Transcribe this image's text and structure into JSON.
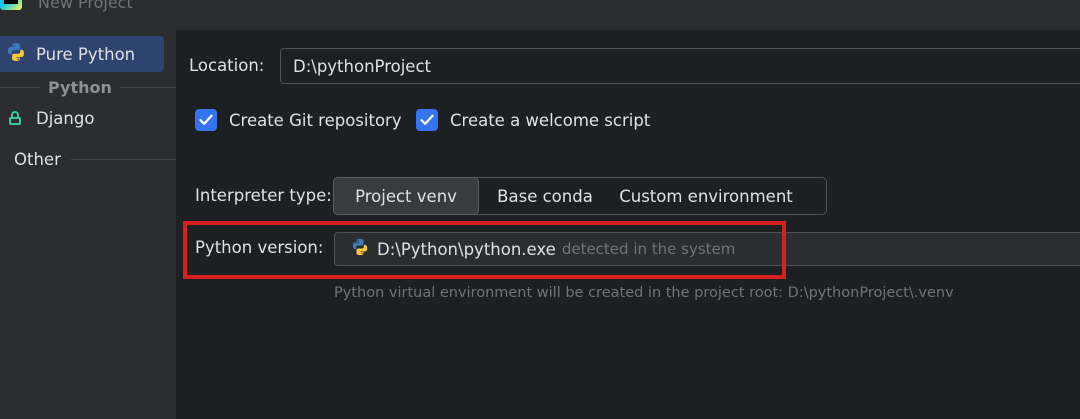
{
  "window": {
    "title": "New Project",
    "app_icon": "pycharm-logo-icon"
  },
  "sidebar": {
    "selected_item": {
      "label": "Pure Python",
      "icon": "python-icon"
    },
    "group_label": "Python",
    "items": [
      {
        "label": "Django",
        "icon": "lock-icon"
      }
    ],
    "other_label": "Other"
  },
  "main": {
    "location": {
      "label": "Location:",
      "value": "D:\\pythonProject"
    },
    "checkboxes": [
      {
        "label": "Create Git repository",
        "checked": true
      },
      {
        "label": "Create a welcome script",
        "checked": true
      }
    ],
    "interpreter_type": {
      "label": "Interpreter type:",
      "options": [
        "Project venv",
        "Base conda",
        "Custom environment"
      ],
      "selected": "Project venv"
    },
    "python_version": {
      "label": "Python version:",
      "path": "D:\\Python\\python.exe",
      "hint": "detected in the system",
      "icon": "python-icon"
    },
    "venv_note": "Python virtual environment will be created in the project root: D:\\pythonProject\\.venv"
  },
  "colors": {
    "accent": "#3574f0",
    "selection": "#2e436e",
    "highlight_border": "#d62020",
    "panel_bg": "#1e1f22",
    "sidebar_bg": "#2b2d30"
  }
}
